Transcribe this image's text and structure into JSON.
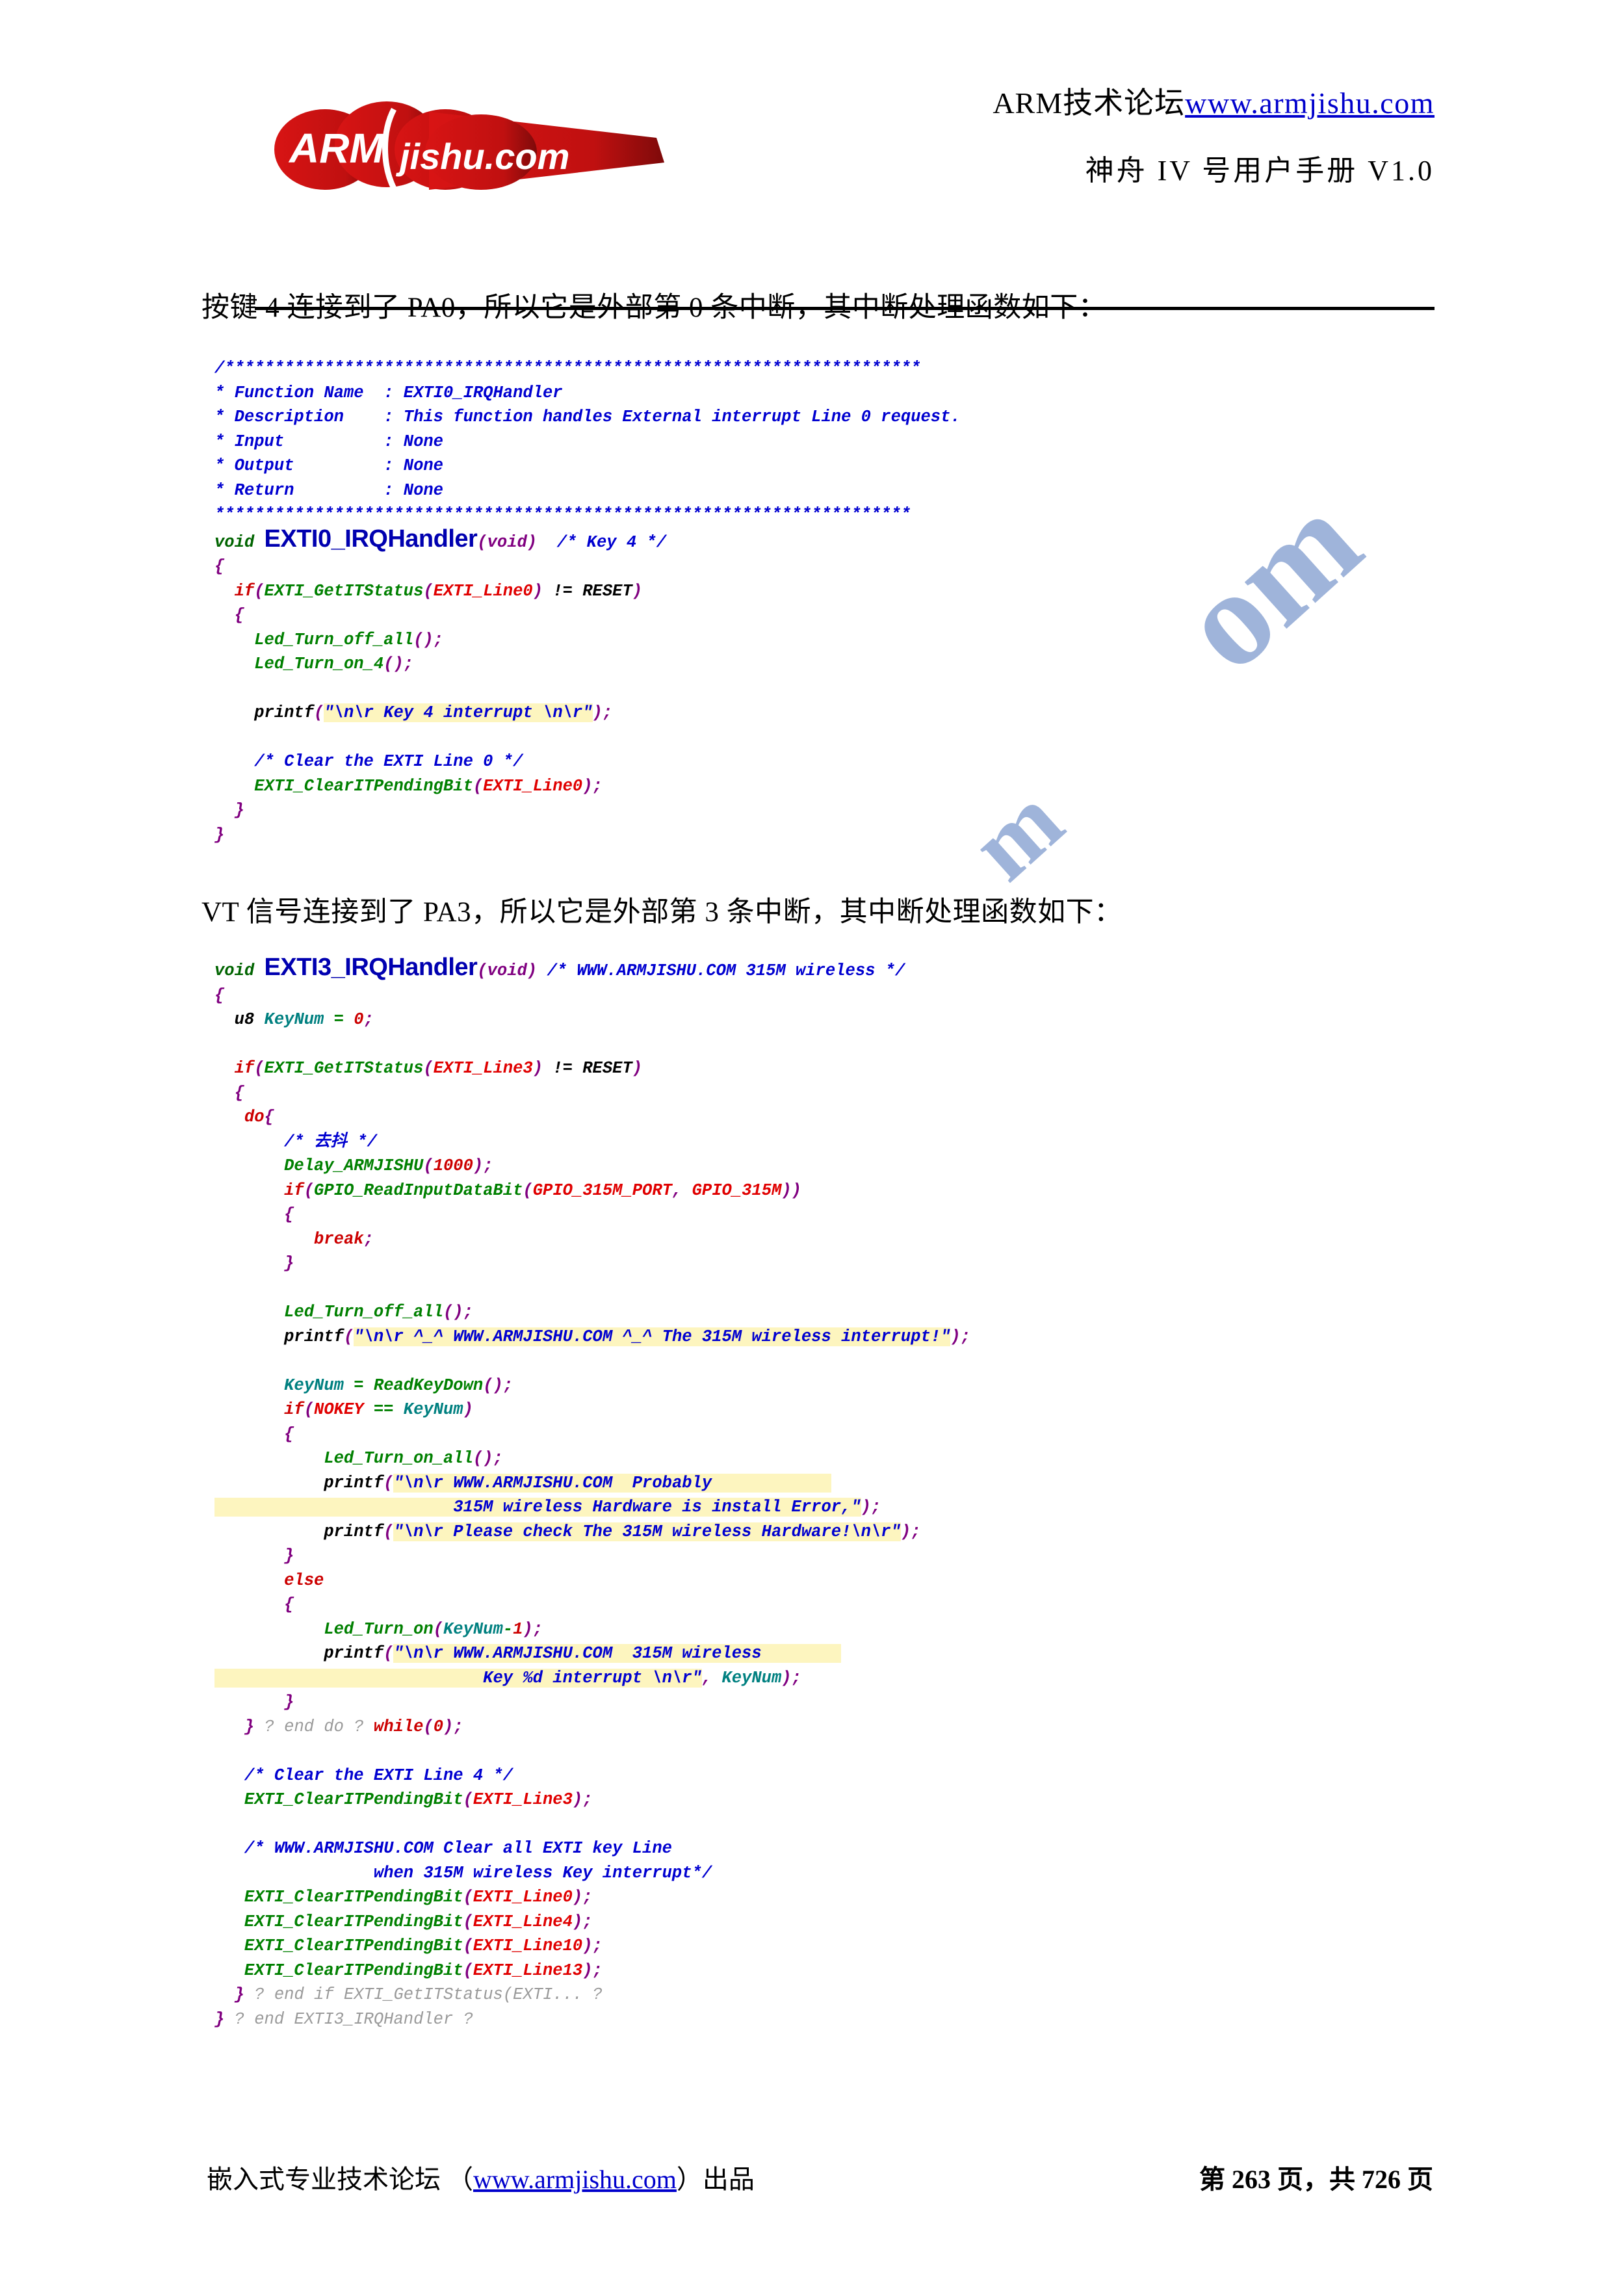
{
  "header": {
    "logo_text": "ARM",
    "logo_text2": "jishu.com",
    "site_line_prefix": "ARM技术论坛",
    "site_url": "www.armjishu.com",
    "manual_title": "神舟 IV 号用户手册 V1.0"
  },
  "paragraphs": {
    "p1": "按键 4 连接到了 PA0，所以它是外部第 0 条中断，其中断处理函数如下：",
    "p2": "VT 信号连接到了 PA3，所以它是外部第 3 条中断，其中断处理函数如下："
  },
  "watermark": {
    "text1": "om",
    "text2": "m"
  },
  "code_block_1": {
    "banner_top": "/**********************************************************************",
    "banner_bottom": "**********************************************************************",
    "doc_rows": [
      {
        "label": "* Function Name",
        "sep": ": ",
        "value": "EXTI0_IRQHandler"
      },
      {
        "label": "* Description  ",
        "sep": ": ",
        "value": "This function handles External interrupt Line 0 request."
      },
      {
        "label": "* Input        ",
        "sep": ": ",
        "value": "None"
      },
      {
        "label": "* Output       ",
        "sep": ": ",
        "value": "None"
      },
      {
        "label": "* Return       ",
        "sep": ": ",
        "value": "None"
      }
    ],
    "signature": {
      "return_type": "void",
      "name": "EXTI0_IRQHandler",
      "args": "(void)",
      "comment": "/* Key 4 */"
    },
    "lines": [
      "{",
      "  if(EXTI_GetITStatus(EXTI_Line0) != RESET)",
      "  {",
      "    Led_Turn_off_all();",
      "    Led_Turn_on_4();",
      "",
      "    printf(\"\\n\\r Key 4 interrupt \\n\\r\");",
      "",
      "    /* Clear the EXTI Line 0 */",
      "    EXTI_ClearITPendingBit(EXTI_Line0);",
      "  }",
      "}"
    ]
  },
  "code_block_2": {
    "signature": {
      "return_type": "void",
      "name": "EXTI3_IRQHandler",
      "args": "(void)",
      "comment": "/* WWW.ARMJISHU.COM 315M wireless */"
    },
    "lines": [
      "{",
      "  u8 KeyNum = 0;",
      "",
      "  if(EXTI_GetITStatus(EXTI_Line3) != RESET)",
      "  {",
      "   do{",
      "       /* 去抖 */",
      "       Delay_ARMJISHU(1000);",
      "       if(GPIO_ReadInputDataBit(GPIO_315M_PORT, GPIO_315M))",
      "       {",
      "          break;",
      "       }",
      "",
      "       Led_Turn_off_all();",
      "       printf(\"\\n\\r ^_^ WWW.ARMJISHU.COM ^_^ The 315M wireless interrupt!\");",
      "",
      "       KeyNum = ReadKeyDown();",
      "       if(NOKEY == KeyNum)",
      "       {",
      "           Led_Turn_on_all();",
      "           printf(\"\\n\\r WWW.ARMJISHU.COM  Probably",
      "                        315M wireless Hardware is install Error,\");",
      "           printf(\"\\n\\r Please check The 315M wireless Hardware!\\n\\r\");",
      "       }",
      "       else",
      "       {",
      "           Led_Turn_on(KeyNum-1);",
      "           printf(\"\\n\\r WWW.ARMJISHU.COM  315M wireless",
      "                           Key %d interrupt \\n\\r\", KeyNum);",
      "       }",
      "   } ? end do ? while(0);",
      "",
      "   /* Clear the EXTI Line 4 */",
      "   EXTI_ClearITPendingBit(EXTI_Line3);",
      "",
      "   /* WWW.ARMJISHU.COM Clear all EXTI key Line",
      "                when 315M wireless Key interrupt*/",
      "   EXTI_ClearITPendingBit(EXTI_Line0);",
      "   EXTI_ClearITPendingBit(EXTI_Line4);",
      "   EXTI_ClearITPendingBit(EXTI_Line10);",
      "   EXTI_ClearITPendingBit(EXTI_Line13);",
      "  } ? end if EXTI_GetITStatus(EXTI... ?",
      "} ? end EXTI3_IRQHandler ?"
    ]
  },
  "footer": {
    "left_prefix": "嵌入式专业技术论坛 （",
    "left_url": "www.armjishu.com",
    "left_suffix": "）出品",
    "page_text": "第 263 页，共 726 页"
  },
  "colors": {
    "comment_blue": "#0000d0",
    "keyword_red": "#cc0000",
    "function_green": "#008000",
    "macro_red": "#e00000",
    "punct_purple": "#800080",
    "variable_teal": "#008080",
    "highlight_yellow": "#fdf5bf",
    "link_blue": "#0000cc",
    "logo_red": "#cc1111"
  }
}
